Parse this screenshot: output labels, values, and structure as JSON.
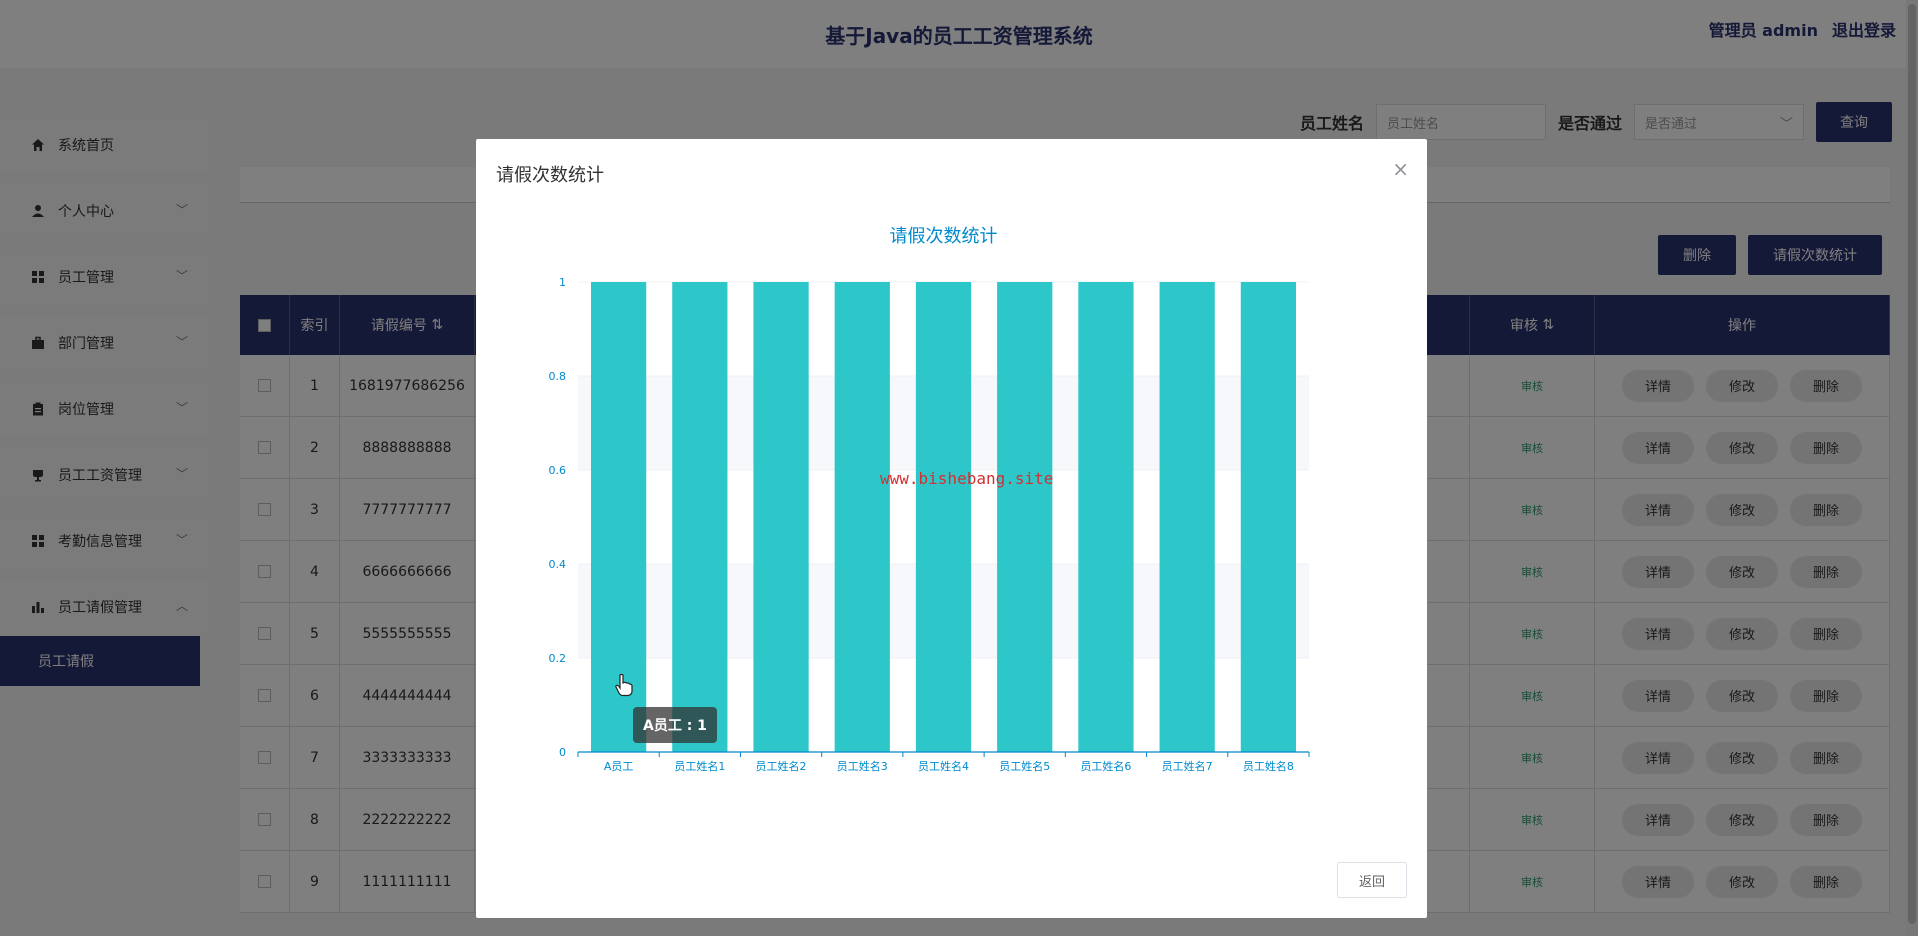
{
  "header": {
    "title": "基于Java的员工工资管理系统",
    "user": "管理员 admin",
    "logout": "退出登录"
  },
  "sidebar": {
    "items": [
      {
        "label": "系统首页",
        "icon": "home-icon"
      },
      {
        "label": "个人中心",
        "icon": "person-icon"
      },
      {
        "label": "员工管理",
        "icon": "grid-icon"
      },
      {
        "label": "部门管理",
        "icon": "briefcase-icon"
      },
      {
        "label": "岗位管理",
        "icon": "clipboard-icon"
      },
      {
        "label": "员工工资管理",
        "icon": "cup-icon"
      },
      {
        "label": "考勤信息管理",
        "icon": "grid-icon"
      },
      {
        "label": "员工请假管理",
        "icon": "bar-chart-icon"
      }
    ],
    "submenu": "员工请假"
  },
  "search": {
    "name_label": "员工姓名",
    "name_placeholder": "员工姓名",
    "pass_label": "是否通过",
    "pass_placeholder": "是否通过",
    "query_button": "查询"
  },
  "actions": {
    "delete": "删除",
    "stats": "请假次数统计"
  },
  "table": {
    "headers": {
      "index": "索引",
      "no": "请假编号",
      "audit": "审核",
      "op": "操作"
    },
    "rows": [
      {
        "idx": "1",
        "no": "1681977686256"
      },
      {
        "idx": "2",
        "no": "8888888888"
      },
      {
        "idx": "3",
        "no": "7777777777"
      },
      {
        "idx": "4",
        "no": "6666666666"
      },
      {
        "idx": "5",
        "no": "5555555555"
      },
      {
        "idx": "6",
        "no": "4444444444"
      },
      {
        "idx": "7",
        "no": "3333333333"
      },
      {
        "idx": "8",
        "no": "2222222222"
      },
      {
        "idx": "9",
        "no": "1111111111"
      }
    ],
    "audit_link": "审核",
    "op_detail": "详情",
    "op_edit": "修改",
    "op_delete": "删除"
  },
  "modal": {
    "title": "请假次数统计",
    "back": "返回",
    "watermark": "www.bishebang.site",
    "tooltip": "A员工 : 1"
  },
  "chart_data": {
    "type": "bar",
    "title": "请假次数统计",
    "categories": [
      "A员工",
      "员工姓名1",
      "员工姓名2",
      "员工姓名3",
      "员工姓名4",
      "员工姓名5",
      "员工姓名6",
      "员工姓名7",
      "员工姓名8"
    ],
    "values": [
      1,
      1,
      1,
      1,
      1,
      1,
      1,
      1,
      1
    ],
    "ylim": [
      0,
      1
    ],
    "yticks": [
      "0",
      "0.2",
      "0.4",
      "0.6",
      "0.8",
      "1"
    ],
    "grid": true,
    "bar_color": "#2ec7c9",
    "axis_color": "#008acd"
  }
}
